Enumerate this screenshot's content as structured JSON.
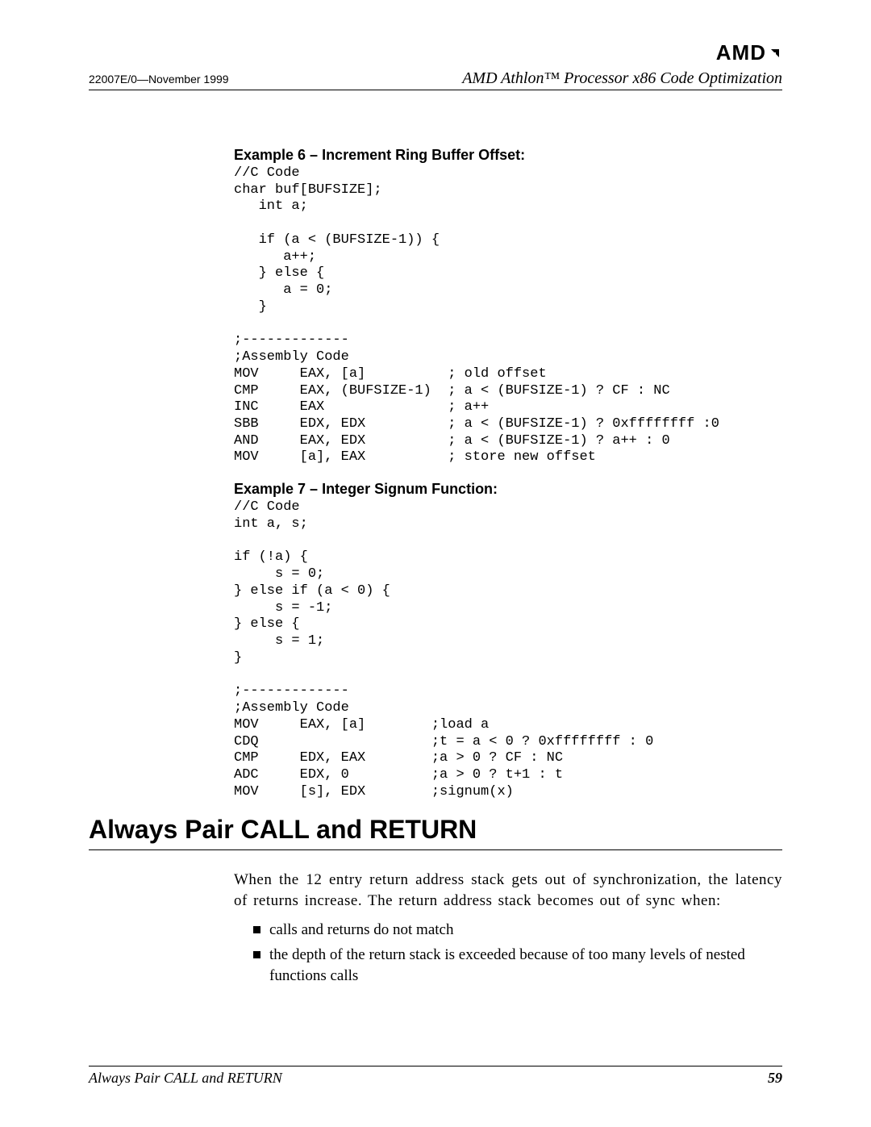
{
  "header": {
    "logo_text": "AMD",
    "doc_id": "22007E/0—November 1999",
    "doc_title": "AMD Athlon™ Processor x86 Code Optimization"
  },
  "example6": {
    "heading": "Example 6 – Increment Ring Buffer Offset:",
    "code": "//C Code\nchar buf[BUFSIZE];\n   int a;\n\n   if (a < (BUFSIZE-1)) {\n      a++;\n   } else {\n      a = 0;\n   }\n\n;-------------\n;Assembly Code\nMOV     EAX, [a]          ; old offset\nCMP     EAX, (BUFSIZE-1)  ; a < (BUFSIZE-1) ? CF : NC\nINC     EAX               ; a++\nSBB     EDX, EDX          ; a < (BUFSIZE-1) ? 0xffffffff :0\nAND     EAX, EDX          ; a < (BUFSIZE-1) ? a++ : 0\nMOV     [a], EAX          ; store new offset"
  },
  "example7": {
    "heading": "Example 7 – Integer Signum Function:",
    "code": "//C Code\nint a, s;\n\nif (!a) {\n     s = 0;\n} else if (a < 0) {\n     s = -1;\n} else {\n     s = 1;\n}\n\n;-------------\n;Assembly Code\nMOV     EAX, [a]        ;load a\nCDQ                     ;t = a < 0 ? 0xffffffff : 0\nCMP     EDX, EAX        ;a > 0 ? CF : NC\nADC     EDX, 0          ;a > 0 ? t+1 : t\nMOV     [s], EDX        ;signum(x)"
  },
  "section": {
    "heading": "Always Pair CALL and RETURN",
    "paragraph": "When the 12 entry return address stack gets out of synchronization, the latency of returns increase. The return address stack becomes out of sync when:",
    "bullets": [
      "calls and returns do not match",
      "the depth of the return stack is exceeded because of too many levels of nested functions calls"
    ]
  },
  "footer": {
    "left": "Always Pair CALL and RETURN",
    "page_number": "59"
  }
}
